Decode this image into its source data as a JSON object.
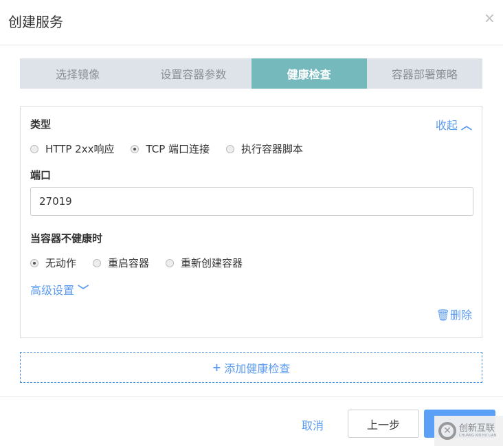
{
  "dialog": {
    "title": "创建服务",
    "close": "×"
  },
  "tabs": [
    {
      "label": "选择镜像"
    },
    {
      "label": "设置容器参数"
    },
    {
      "label": "健康检查",
      "active": true
    },
    {
      "label": "容器部署策略"
    }
  ],
  "health": {
    "type_label": "类型",
    "collapse": "收起",
    "collapse_icon": "chevron-up",
    "types": [
      {
        "label": "HTTP 2xx响应",
        "checked": false
      },
      {
        "label": "TCP 端口连接",
        "checked": true
      },
      {
        "label": "执行容器脚本",
        "checked": false
      }
    ],
    "port_label": "端口",
    "port_value": "27019",
    "unhealthy_label": "当容器不健康时",
    "actions": [
      {
        "label": "无动作",
        "checked": true
      },
      {
        "label": "重启容器",
        "checked": false
      },
      {
        "label": "重新创建容器",
        "checked": false
      }
    ],
    "advanced": "高级设置",
    "delete": "删除"
  },
  "add_check": "添加健康检查",
  "footer": {
    "cancel": "取消",
    "prev": "上一步"
  },
  "watermark": {
    "name": "创新互联",
    "pinyin": "CHUANG XIN HU LIAN"
  }
}
